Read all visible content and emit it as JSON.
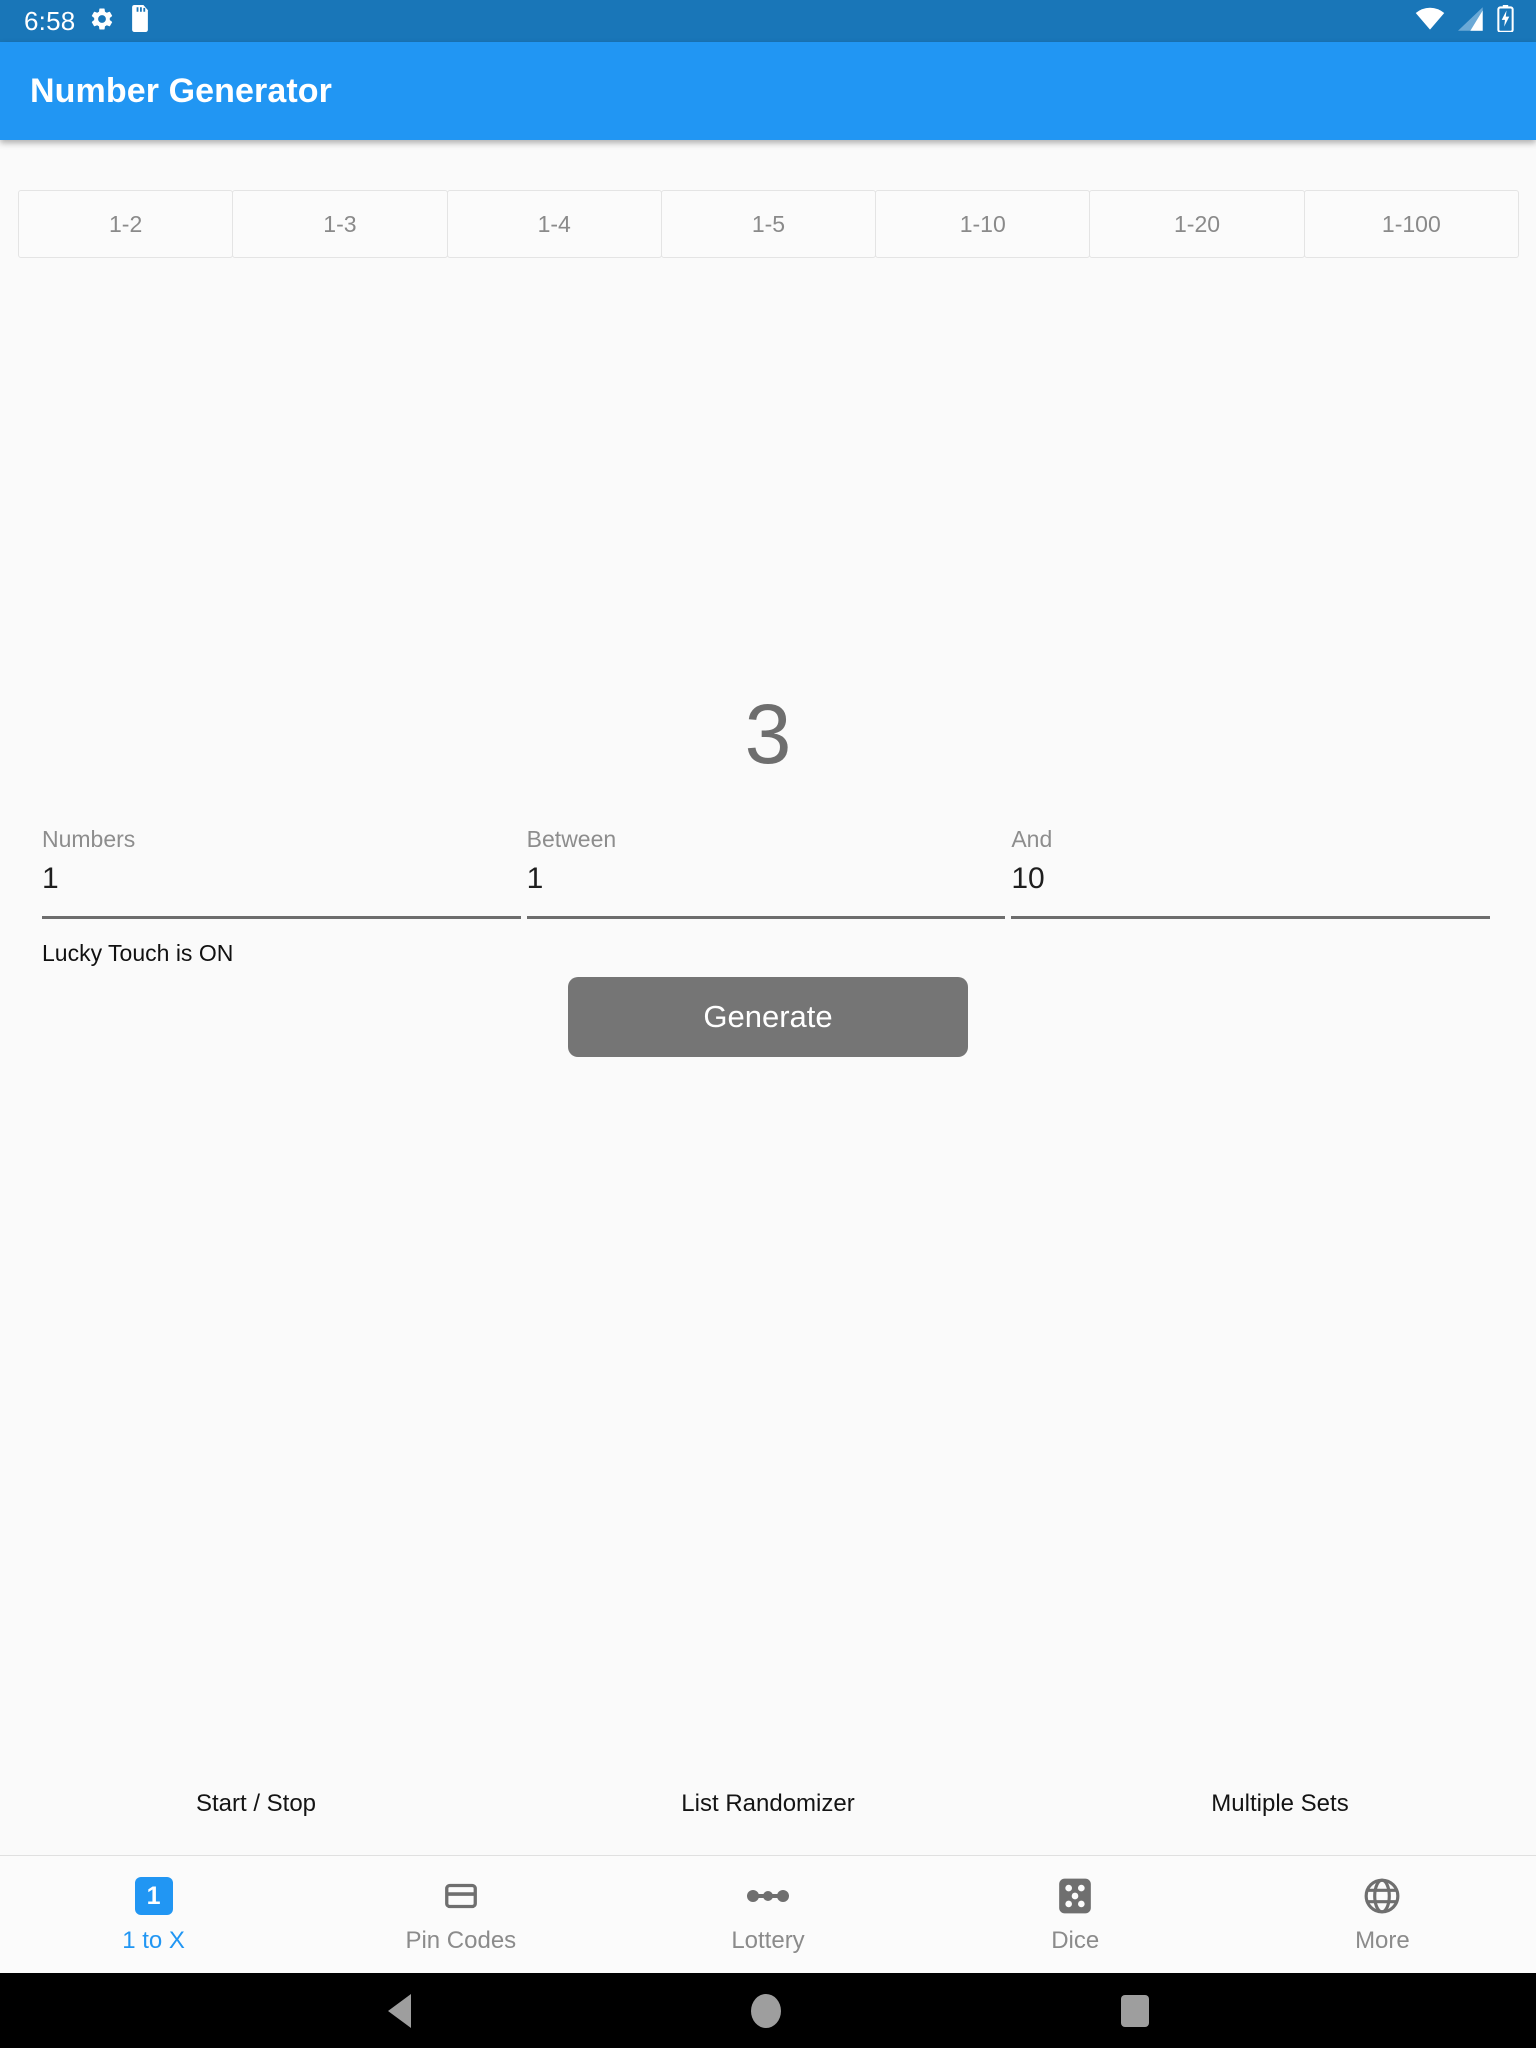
{
  "status_bar": {
    "clock": "6:58",
    "left_icons": [
      "gear-icon",
      "sd-card-icon"
    ],
    "right_icons": [
      "wifi-icon",
      "cellular-signal-icon",
      "battery-charging-icon"
    ],
    "background": "#1976b8"
  },
  "app_bar": {
    "title": "Number Generator",
    "background": "#2196f3"
  },
  "range_tabs": [
    {
      "label": "1-2"
    },
    {
      "label": "1-3"
    },
    {
      "label": "1-4"
    },
    {
      "label": "1-5"
    },
    {
      "label": "1-10"
    },
    {
      "label": "1-20"
    },
    {
      "label": "1-100"
    }
  ],
  "result": {
    "value": "3"
  },
  "inputs": [
    {
      "label": "Numbers",
      "value": "1"
    },
    {
      "label": "Between",
      "value": "1"
    },
    {
      "label": "And",
      "value": "10"
    }
  ],
  "lucky_touch": {
    "status_text": "Lucky Touch is ON"
  },
  "generate": {
    "label": "Generate",
    "background": "#757575"
  },
  "quick_links": [
    {
      "label": "Start / Stop"
    },
    {
      "label": "List Randomizer"
    },
    {
      "label": "Multiple Sets"
    }
  ],
  "bottom_nav": {
    "active_color": "#2196f3",
    "inactive_color": "#8b8b8b",
    "items": [
      {
        "label": "1 to X",
        "icon": "number-one-badge-icon",
        "active": true
      },
      {
        "label": "Pin Codes",
        "icon": "card-icon",
        "active": false
      },
      {
        "label": "Lottery",
        "icon": "lottery-balls-icon",
        "active": false
      },
      {
        "label": "Dice",
        "icon": "dice-icon",
        "active": false
      },
      {
        "label": "More",
        "icon": "globe-icon",
        "active": false
      }
    ]
  },
  "android_nav": {
    "back": "back-triangle-icon",
    "home": "home-circle-icon",
    "recents": "recents-square-icon"
  }
}
